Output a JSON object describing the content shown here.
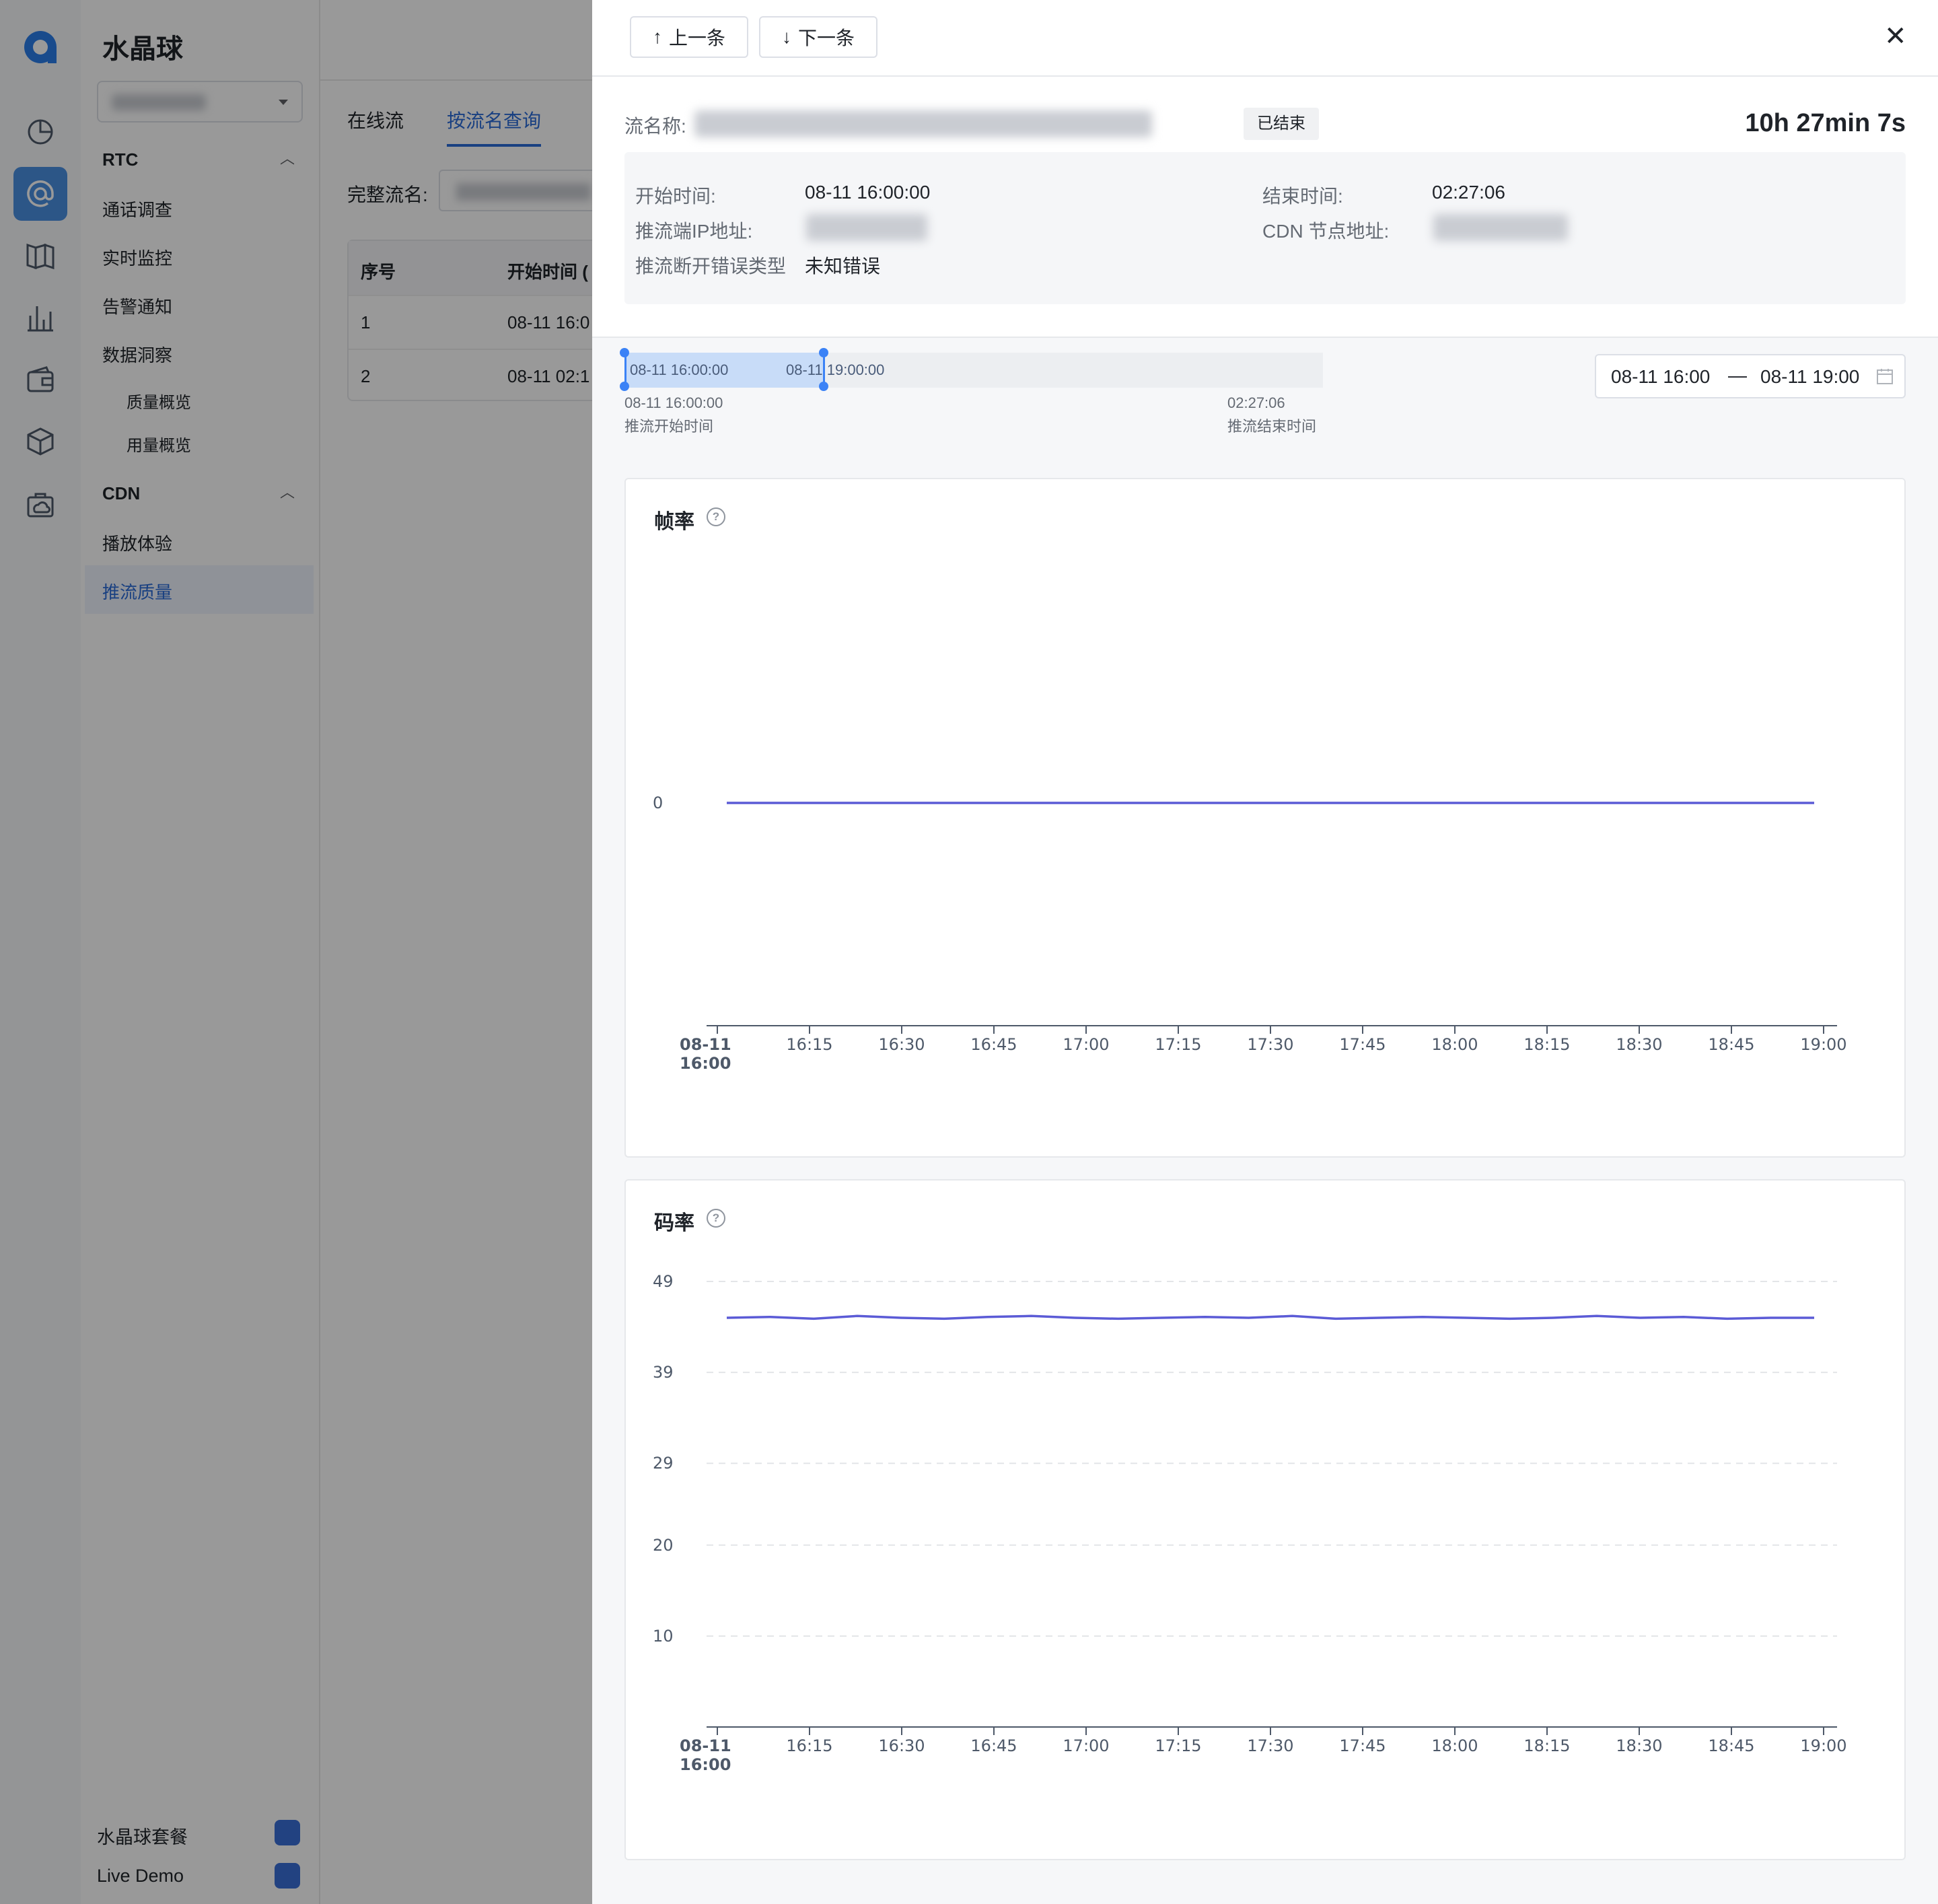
{
  "rail": {
    "icons": [
      "logo-icon",
      "pie-chart-icon",
      "at-sign-icon",
      "book-icon",
      "bar-chart-icon",
      "wallet-icon",
      "cube-icon",
      "cloud-bag-icon"
    ]
  },
  "sidebar": {
    "brand": "水晶球",
    "groups": [
      {
        "title": "RTC",
        "items": [
          "通话调查",
          "实时监控",
          "告警通知",
          "数据洞察"
        ],
        "subitems": [
          "质量概览",
          "用量概览"
        ]
      },
      {
        "title": "CDN",
        "items": [
          "播放体验",
          "推流质量"
        ]
      }
    ],
    "active_item": "推流质量",
    "bottom": [
      {
        "label": "水晶球套餐"
      },
      {
        "label": "Live Demo"
      }
    ]
  },
  "main": {
    "tabs": [
      "在线流",
      "按流名查询"
    ],
    "active_tab": "按流名查询",
    "field_label": "完整流名:",
    "table": {
      "headers": [
        "序号",
        "开始时间 ("
      ],
      "rows": [
        [
          "1",
          "08-11 16:0"
        ],
        [
          "2",
          "08-11 02:1"
        ]
      ]
    }
  },
  "drawer": {
    "prev_label": "上一条",
    "next_label": "下一条",
    "stream_label": "流名称:",
    "status": "已结束",
    "duration": "10h 27min 7s",
    "info": {
      "start_label": "开始时间:",
      "start_value": "08-11 16:00:00",
      "end_label": "结束时间:",
      "end_value": "02:27:06",
      "ip_label": "推流端IP地址:",
      "cdn_label": "CDN 节点地址:",
      "err_label": "推流断开错误类型",
      "err_value": "未知错误"
    },
    "timeline": {
      "sel_start": "08-11 16:00:00",
      "sel_end": "08-11 19:00:00",
      "start_time": "08-11 16:00:00",
      "start_caption": "推流开始时间",
      "end_time": "02:27:06",
      "end_caption": "推流结束时间",
      "selected_fraction": [
        0,
        0.287
      ]
    },
    "date_range": {
      "from": "08-11 16:00",
      "sep": "—",
      "to": "08-11 19:00"
    }
  },
  "colors": {
    "accent": "#2b6bd8",
    "line": "#5b5bd6",
    "selection": "#3b82f6"
  },
  "chart_data": [
    {
      "type": "line",
      "title": "帧率",
      "x": [
        "08-11 16:00",
        "16:15",
        "16:30",
        "16:45",
        "17:00",
        "17:15",
        "17:30",
        "17:45",
        "18:00",
        "18:15",
        "18:30",
        "18:45",
        "19:00"
      ],
      "xticks": [
        "08-11\n16:00",
        "16:15",
        "16:30",
        "16:45",
        "17:00",
        "17:15",
        "17:30",
        "17:45",
        "18:00",
        "18:15",
        "18:30",
        "18:45",
        "19:00"
      ],
      "yticks": [
        0
      ],
      "ylim": [
        -1,
        1
      ],
      "grid": false,
      "series": [
        {
          "values": [
            0,
            0,
            0,
            0,
            0,
            0,
            0,
            0,
            0,
            0,
            0,
            0,
            0
          ]
        }
      ]
    },
    {
      "type": "line",
      "title": "码率",
      "x": [
        "08-11 16:00",
        "16:15",
        "16:30",
        "16:45",
        "17:00",
        "17:15",
        "17:30",
        "17:45",
        "18:00",
        "18:15",
        "18:30",
        "18:45",
        "19:00"
      ],
      "xticks": [
        "08-11\n16:00",
        "16:15",
        "16:30",
        "16:45",
        "17:00",
        "17:15",
        "17:30",
        "17:45",
        "18:00",
        "18:15",
        "18:30",
        "18:45",
        "19:00"
      ],
      "yticks": [
        10,
        20,
        29,
        39,
        49
      ],
      "ylim": [
        0,
        49
      ],
      "grid": true,
      "series": [
        {
          "values": [
            45,
            45.1,
            44.9,
            45.2,
            45,
            44.9,
            45.1,
            45.2,
            45,
            44.9,
            45,
            45.1,
            45,
            45.2,
            44.9,
            45,
            45.1,
            45,
            44.9,
            45,
            45.2,
            45,
            45.1,
            44.9,
            45,
            45
          ]
        }
      ]
    }
  ]
}
